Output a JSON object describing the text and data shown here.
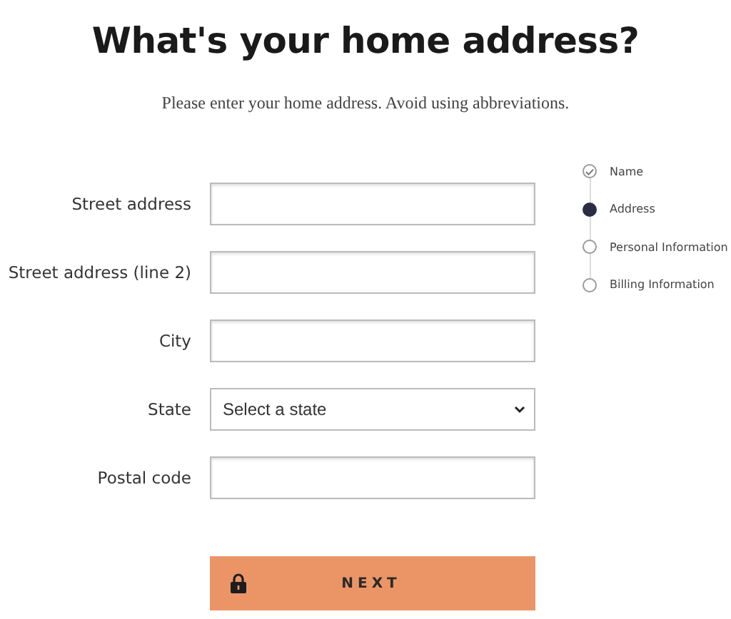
{
  "title": "What's your home address?",
  "subtitle": "Please enter your home address. Avoid using abbreviations.",
  "fields": [
    {
      "label": "Street address",
      "kind": "text"
    },
    {
      "label": "Street address (line 2)",
      "kind": "text"
    },
    {
      "label": "City",
      "kind": "text"
    },
    {
      "label": "State",
      "kind": "select",
      "value": "Select a state"
    },
    {
      "label": "Postal code",
      "kind": "text"
    }
  ],
  "button": {
    "label": "NEXT"
  },
  "steps": [
    {
      "label": "Name",
      "completed": true,
      "selected": false
    },
    {
      "label": "Address",
      "completed": false,
      "selected": true
    },
    {
      "label": "Personal Information",
      "completed": false,
      "selected": false
    },
    {
      "label": "Billing Information",
      "completed": false,
      "selected": false
    }
  ]
}
